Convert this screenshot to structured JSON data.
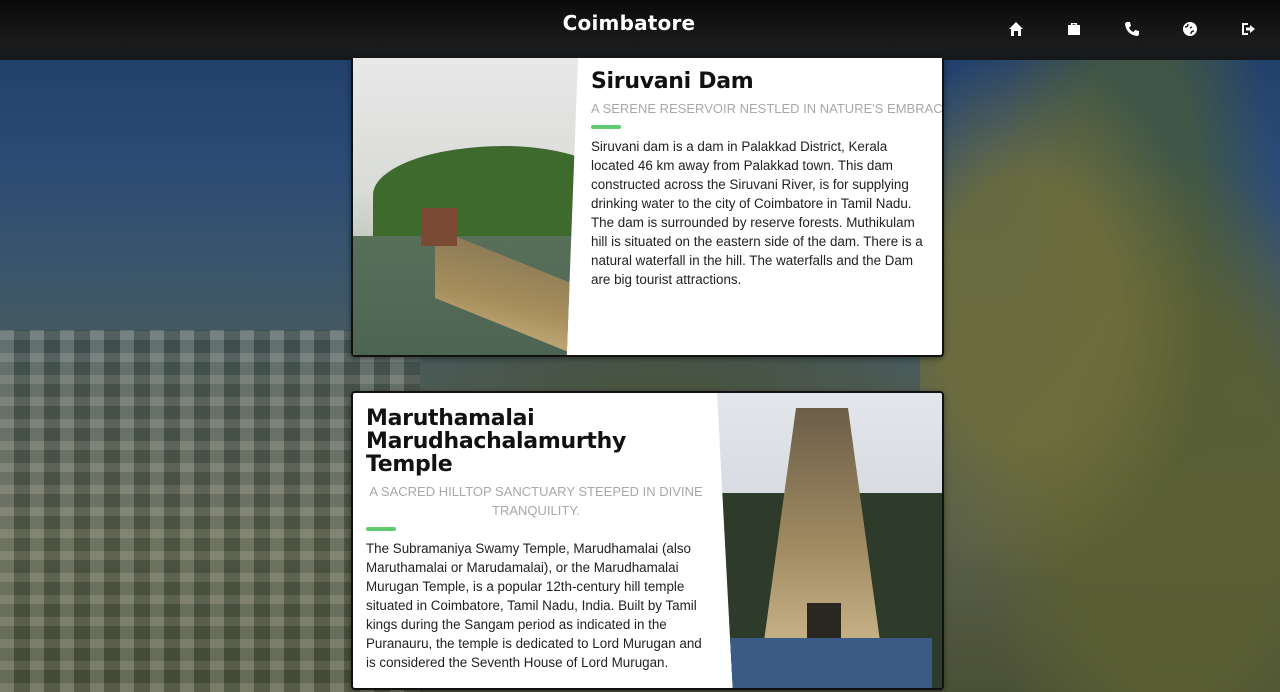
{
  "header": {
    "title": "Coimbatore",
    "nav": [
      {
        "name": "home",
        "icon": "home-icon"
      },
      {
        "name": "briefcase",
        "icon": "briefcase-icon"
      },
      {
        "name": "phone",
        "icon": "phone-icon"
      },
      {
        "name": "globe",
        "icon": "globe-icon"
      },
      {
        "name": "logout",
        "icon": "logout-icon"
      }
    ]
  },
  "cards": [
    {
      "title": "Siruvani Dam",
      "subtitle": "A SERENE RESERVOIR NESTLED IN NATURE'S EMBRACE",
      "body": "Siruvani dam is a dam in Palakkad District, Kerala located 46 km away from Palakkad town. This dam constructed across the Siruvani River, is for supplying drinking water to the city of Coimbatore in Tamil Nadu. The dam is surrounded by reserve forests. Muthikulam hill is situated on the eastern side of the dam. There is a natural waterfall in the hill. The waterfalls and the Dam are big tourist attractions."
    },
    {
      "title": "Maruthamalai Marudhachalamurthy Temple",
      "subtitle": "A SACRED HILLTOP SANCTUARY STEEPED IN DIVINE TRANQUILITY.",
      "body": "The Subramaniya Swamy Temple, Marudhamalai (also Maruthamalai or Marudamalai), or the Marudhamalai Murugan Temple, is a popular 12th-century hill temple situated in Coimbatore, Tamil Nadu, India. Built by Tamil kings during the Sangam period as indicated in the Puranauru, the temple is dedicated to Lord Murugan and is considered the Seventh House of Lord Murugan."
    }
  ],
  "colors": {
    "accent": "#5ecb6e",
    "subtitle": "#a8a8a8",
    "header_bg": "#111111"
  }
}
